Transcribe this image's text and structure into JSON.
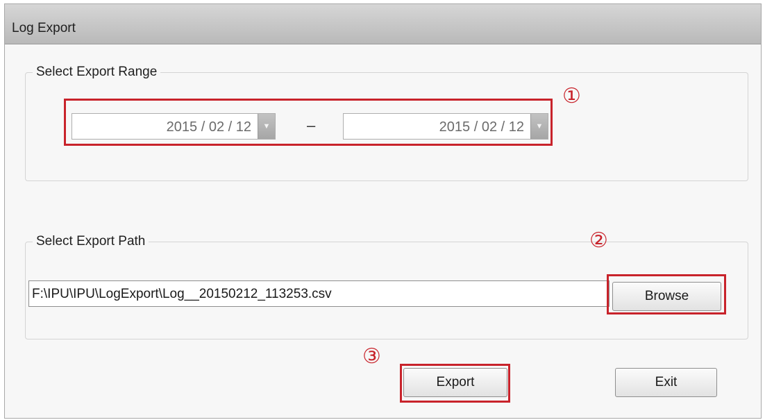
{
  "window": {
    "title": "Log Export"
  },
  "range_group": {
    "legend": "Select Export Range",
    "start_date": "2015 / 02 / 12",
    "end_date": "2015 / 02 / 12",
    "separator": "–"
  },
  "path_group": {
    "legend": "Select Export Path",
    "path_value": "F:\\IPU\\IPU\\LogExport\\Log__20150212_113253.csv",
    "browse_label": "Browse"
  },
  "actions": {
    "export_label": "Export",
    "exit_label": "Exit"
  },
  "annotations": {
    "marker_1": "①",
    "marker_2": "②",
    "marker_3": "③"
  },
  "colors": {
    "highlight": "#c8232b"
  }
}
